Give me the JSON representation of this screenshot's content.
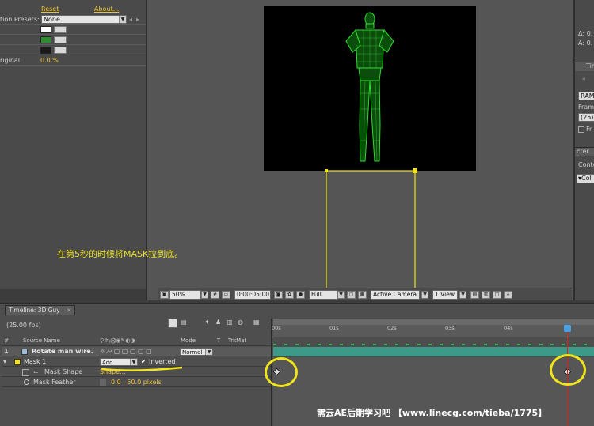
{
  "effect_controls": {
    "reset_label": "Reset",
    "about_label": "About...",
    "presets_label": "tion Presets:",
    "presets_value": "None",
    "original_label": "riginal",
    "original_value": "0.0 %",
    "swatch_colors": [
      "#ffffff",
      "#2e8b2e",
      "#1a1a1a"
    ]
  },
  "viewer_toolbar": {
    "zoom": "50%",
    "timecode": "0:00:05:00",
    "resolution": "Full",
    "camera": "Active Camera",
    "view": "1 View"
  },
  "right_panel": {
    "delta_label": "Δ: 0.",
    "a_label": "A: 0.",
    "tab_label": "Tim",
    "ram_label": "RAM",
    "frame_label": "Fram",
    "frame_value": "(25)",
    "fr_label": "Fr",
    "cter_label": "cter",
    "cont_label": "Conte",
    "col_label": "Col"
  },
  "timeline": {
    "tab_title": "Timeline: 3D Guy",
    "fps": "(25.00 fps)",
    "columns": {
      "num": "#",
      "source": "Source Name",
      "mode": "Mode",
      "t": "T",
      "trkmat": "TrkMat"
    },
    "layer_number": "1",
    "layer_name": "Rotate man wire.",
    "layer_mode": "Normal",
    "mask_name": "Mask 1",
    "mask_mode": "Add",
    "inverted_label": "Inverted",
    "mask_shape_label": "Mask Shape",
    "mask_shape_value": "Shape...",
    "mask_feather_label": "Mask Feather",
    "mask_feather_value": "0.0 , 50.0 pixels",
    "ticks": [
      "00s",
      "01s",
      "02s",
      "03s",
      "04s"
    ]
  },
  "annotation_text": "在第5秒的时候将MASK拉到底。",
  "watermark": "需云AE后期学习吧 【www.linecg.com/tieba/1775】",
  "accent_color": "#f1e41a"
}
